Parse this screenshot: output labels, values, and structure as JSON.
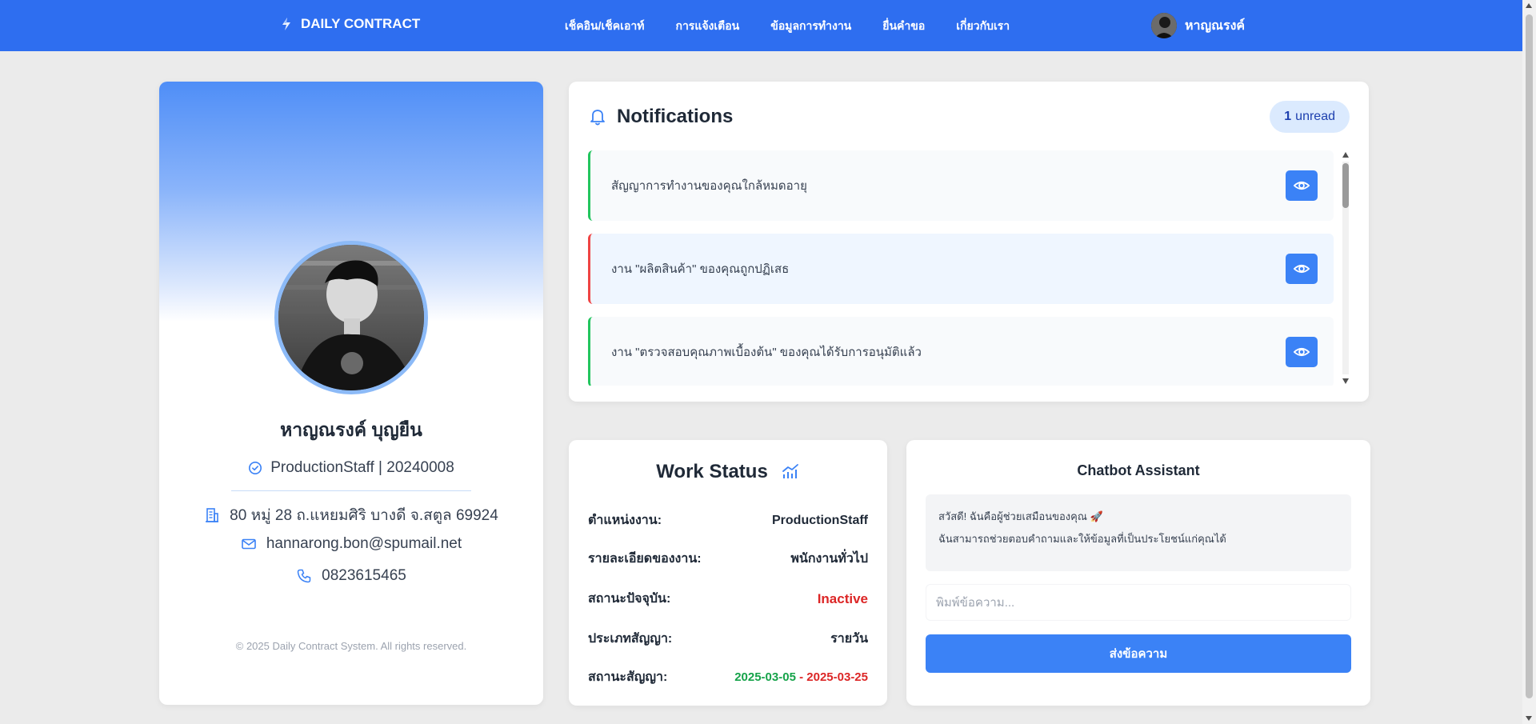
{
  "navbar": {
    "brand": "DAILY CONTRACT",
    "links": [
      {
        "label": "เช็คอิน/เช็คเอาท์"
      },
      {
        "label": "การแจ้งเตือน"
      },
      {
        "label": "ข้อมูลการทำงาน"
      },
      {
        "label": "ยื่นคำขอ"
      },
      {
        "label": "เกี่ยวกับเรา"
      }
    ],
    "user_name": "หาญณรงค์",
    "color": "#2e6ef0"
  },
  "profile": {
    "name": "หาญณรงค์ บุญยืน",
    "role": "ProductionStaff | 20240008",
    "address": "80 หมู่ 28 ถ.แหยมศิริ บางดี จ.สตูล 69924",
    "email": "hannarong.bon@spumail.net",
    "phone": "0823615465",
    "footer": "© 2025 Daily Contract System. All rights reserved."
  },
  "notifications": {
    "title": "Notifications",
    "unread_count": "1",
    "unread_label": "unread",
    "items": [
      {
        "text": "สัญญาการทำงานของคุณใกล้หมดอายุ",
        "accent": "#22c55e",
        "bg": "#f8fafc"
      },
      {
        "text": "งาน \"ผลิตสินค้า\" ของคุณถูกปฏิเสธ",
        "accent": "#ef4444",
        "bg": "#eff6ff"
      },
      {
        "text": "งาน \"ตรวจสอบคุณภาพเบื้องต้น\" ของคุณได้รับการอนุมัติแล้ว",
        "accent": "#22c55e",
        "bg": "#f8fafc"
      }
    ]
  },
  "work_status": {
    "title": "Work Status",
    "rows": [
      {
        "label": "ตำแหน่งงาน:",
        "value": "ProductionStaff"
      },
      {
        "label": "รายละเอียดของงาน:",
        "value": "พนักงานทั่วไป"
      },
      {
        "label": "สถานะปัจจุบัน:",
        "value": "Inactive",
        "color": "#dc2626"
      },
      {
        "label": "ประเภทสัญญา:",
        "value": "รายวัน"
      },
      {
        "label": "สถานะสัญญา:",
        "start": "2025-03-05",
        "sep": " - ",
        "end": "2025-03-25",
        "start_color": "#16a34a",
        "end_color": "#dc2626"
      }
    ]
  },
  "chatbot": {
    "title": "Chatbot Assistant",
    "greeting_line1": "สวัสดี! ฉันคือผู้ช่วยเสมือนของคุณ 🚀",
    "greeting_line2": "ฉันสามารถช่วยตอบคำถามและให้ข้อมูลที่เป็นประโยชน์แก่คุณได้",
    "input_placeholder": "พิมพ์ข้อความ...",
    "send_label": "ส่งข้อความ"
  },
  "icons": {
    "brand": "bolt-icon",
    "bell": "bell-icon",
    "eye": "eye-icon",
    "check": "check-circle-icon",
    "building": "building-icon",
    "mail": "mail-icon",
    "phone": "phone-icon",
    "chart": "chart-icon"
  }
}
